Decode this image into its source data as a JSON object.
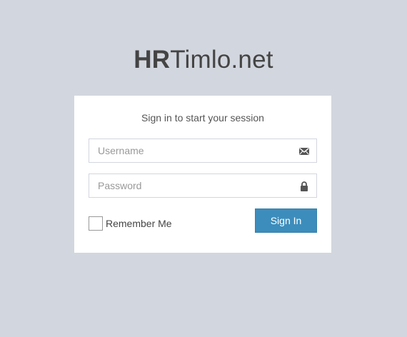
{
  "logo": {
    "bold": "HR",
    "light": "Timlo.net"
  },
  "login": {
    "message": "Sign in to start your session",
    "username_placeholder": "Username",
    "username_value": "",
    "username_icon": "envelope-icon",
    "password_placeholder": "Password",
    "password_value": "",
    "password_icon": "lock-icon",
    "remember_label": "Remember Me",
    "remember_checked": false,
    "signin_label": "Sign In"
  },
  "colors": {
    "background": "#d2d6de",
    "box": "#ffffff",
    "primary_button": "#3c8dbc",
    "text": "#444444",
    "icon": "#555555"
  }
}
